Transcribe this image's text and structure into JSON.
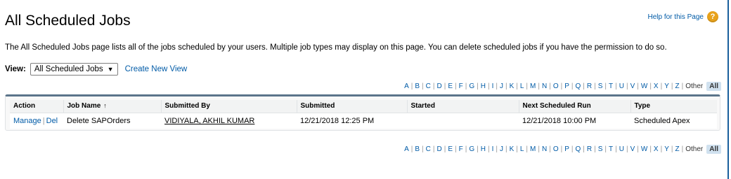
{
  "page": {
    "title": "All Scheduled Jobs",
    "help_link": "Help for this Page",
    "help_icon": "help-icon",
    "description": "The All Scheduled Jobs page lists all of the jobs scheduled by your users. Multiple job types may display on this page. You can delete scheduled jobs if you have the permission to do so."
  },
  "view": {
    "label": "View:",
    "selected": "All Scheduled Jobs",
    "create_link": "Create New View"
  },
  "alpha_filter": {
    "letters": [
      "A",
      "B",
      "C",
      "D",
      "E",
      "F",
      "G",
      "H",
      "I",
      "J",
      "K",
      "L",
      "M",
      "N",
      "O",
      "P",
      "Q",
      "R",
      "S",
      "T",
      "U",
      "V",
      "W",
      "X",
      "Y",
      "Z"
    ],
    "other": "Other",
    "all": "All"
  },
  "table": {
    "columns": [
      "Action",
      "Job Name",
      "Submitted By",
      "Submitted",
      "Started",
      "Next Scheduled Run",
      "Type"
    ],
    "sort_indicator": "↑",
    "rows": [
      {
        "action_manage": "Manage",
        "action_sep": "|",
        "action_del": "Del",
        "job_name": "Delete SAPOrders",
        "submitted_by": "VIDIYALA, AKHIL KUMAR",
        "submitted": "12/21/2018 12:25 PM",
        "started": "",
        "next_run": "12/21/2018 10:00 PM",
        "type": "Scheduled Apex"
      }
    ]
  },
  "colors": {
    "link": "#015ba7",
    "header_bar": "#5b748a",
    "help_icon": "#e8a21b",
    "all_highlight": "#d0e1ef"
  }
}
